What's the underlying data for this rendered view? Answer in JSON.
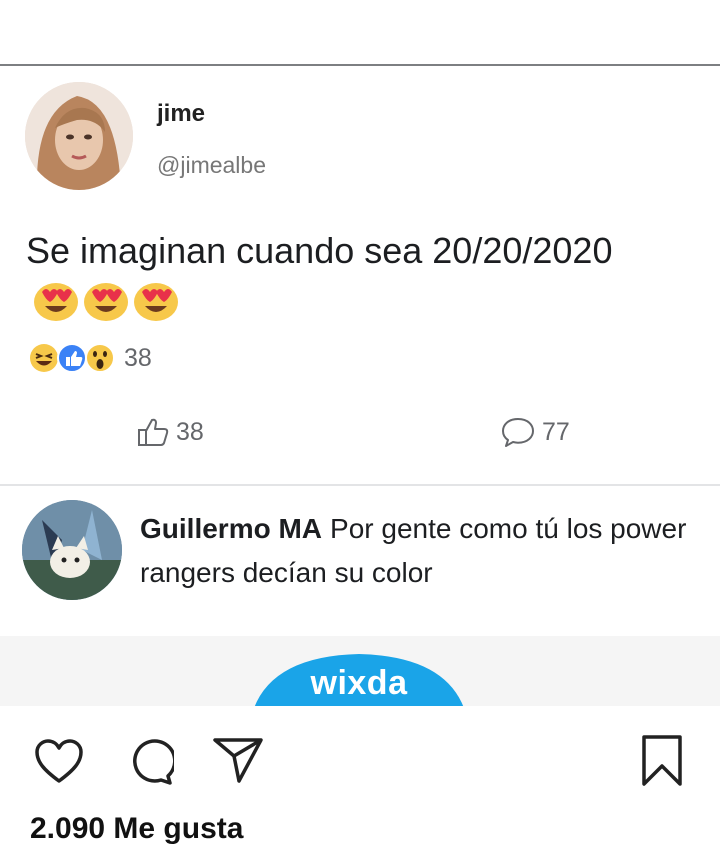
{
  "post": {
    "display_name": "jime",
    "handle": "@jimealbe",
    "text": "Se imaginan cuando sea 20/20/2020",
    "emojis": [
      "heart-eyes-emoji",
      "heart-eyes-emoji",
      "heart-eyes-emoji"
    ],
    "reactions": {
      "icons": [
        "laugh-reaction-icon",
        "like-reaction-icon",
        "wow-reaction-icon"
      ],
      "count": "38"
    },
    "actions": {
      "like_count": "38",
      "comment_count": "77"
    }
  },
  "comment": {
    "author": "Guillermo MA",
    "text": "Por gente como tú los power rangers decían su color"
  },
  "watermark": {
    "text": "wixda",
    "color": "#1aa4e8"
  },
  "instagram": {
    "icons": [
      "heart-icon",
      "comment-icon",
      "send-icon",
      "bookmark-icon"
    ],
    "likes_text": "2.090 Me gusta"
  },
  "colors": {
    "reaction_yellow": "#f7c84a",
    "reaction_blue": "#3b82f6",
    "muted_text": "#65676b"
  }
}
